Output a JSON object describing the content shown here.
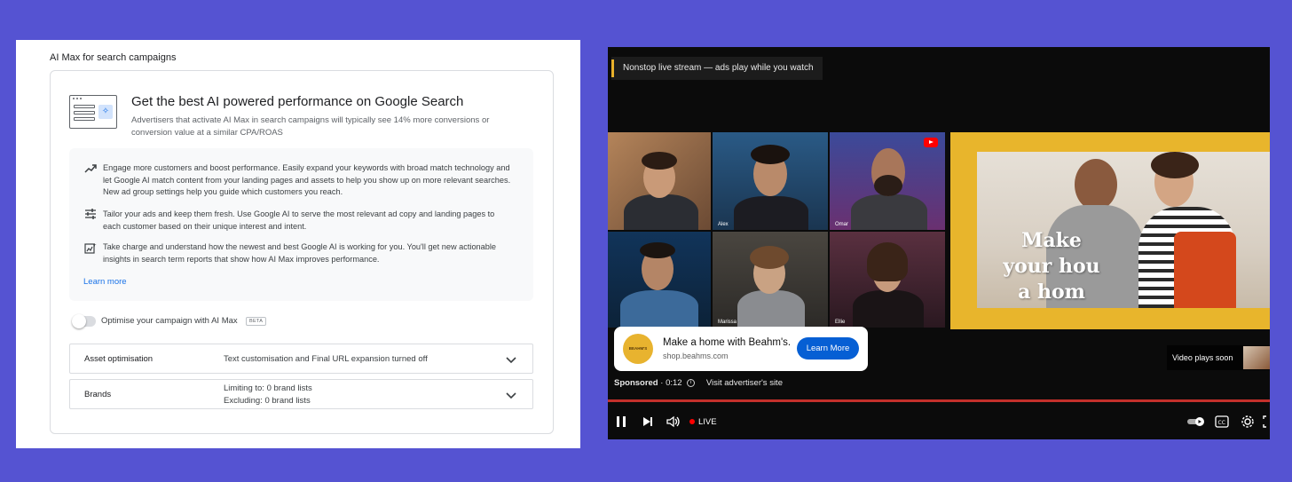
{
  "colors": {
    "background": "#5553d2",
    "link_blue": "#1a73e8",
    "youtube_red": "#ff0000",
    "cta_blue": "#065fd4",
    "ad_frame_gold": "#e8b52c"
  },
  "ads_panel": {
    "section_title": "AI Max for search campaigns",
    "hero": {
      "icon": "ai-max-illustration-icon",
      "heading": "Get the best AI powered performance on Google Search",
      "subtext": "Advertisers that activate AI Max in search campaigns will typically see 14% more conversions or conversion value at a similar CPA/ROAS"
    },
    "benefits": [
      {
        "icon": "trending-up-icon",
        "text": "Engage more customers and boost performance. Easily expand your keywords with broad match technology and let Google AI match content from your landing pages and assets to help you show up on more relevant searches. New ad group settings help you guide which customers you reach."
      },
      {
        "icon": "tune-sliders-icon",
        "text": "Tailor your ads and keep them fresh. Use Google AI to serve the most relevant ad copy and landing pages to each customer based on their unique interest and intent."
      },
      {
        "icon": "insights-chart-icon",
        "text": "Take charge and understand how the newest and best Google AI is working for you. You'll get new actionable insights in search term reports that show how AI Max improves performance."
      }
    ],
    "learn_more": "Learn more",
    "toggle": {
      "label": "Optimise your campaign with AI Max",
      "badge": "BETA",
      "enabled": false
    },
    "rows": [
      {
        "name": "Asset optimisation",
        "value_lines": [
          "Text customisation and Final URL expansion turned off"
        ]
      },
      {
        "name": "Brands",
        "value_lines": [
          "Limiting to: 0 brand lists",
          "Excluding: 0 brand lists"
        ]
      }
    ]
  },
  "video_panel": {
    "banner": "Nonstop live stream — ads play while you watch",
    "participants": [
      "",
      "Alex",
      "Omar",
      "",
      "Marissa",
      "Ellie"
    ],
    "ad_overlay_text": [
      "Make",
      "your hou",
      "a hom"
    ],
    "ad_card": {
      "logo_text": "BEAHM'S",
      "headline": "Make a home with Beahm's.",
      "domain": "shop.beahms.com",
      "cta": "Learn More"
    },
    "sponsored": {
      "label": "Sponsored",
      "time": "0:12",
      "link": "Visit advertiser's site"
    },
    "next_up": "Video plays soon",
    "live_label": "LIVE"
  }
}
